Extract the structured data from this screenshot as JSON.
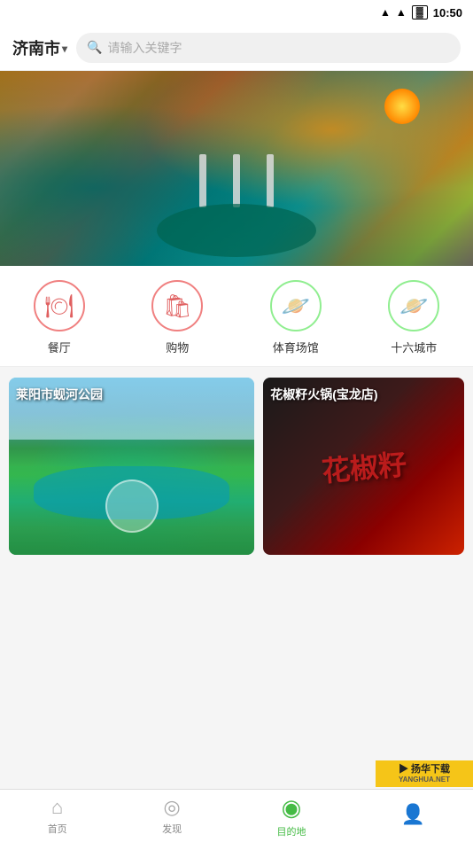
{
  "statusBar": {
    "time": "10:50"
  },
  "header": {
    "city": "济南市",
    "chevron": "▾",
    "search_placeholder": "请输入关键字"
  },
  "categories": [
    {
      "id": "restaurant",
      "label": "餐厅",
      "icon": "🍽",
      "style": "restaurant"
    },
    {
      "id": "shopping",
      "label": "购物",
      "icon": "🛍",
      "style": "shopping"
    },
    {
      "id": "stadium",
      "label": "体育场馆",
      "icon": "🪐",
      "style": "stadium"
    },
    {
      "id": "cities",
      "label": "十六城市",
      "icon": "🪐",
      "style": "cities"
    }
  ],
  "cards": [
    {
      "id": "park",
      "title": "莱阳市蚬河公园",
      "side": "left"
    },
    {
      "id": "restaurant2",
      "title": "花椒籽火锅(宝龙店)",
      "side": "right"
    }
  ],
  "bottomNav": [
    {
      "id": "home",
      "label": "首页",
      "icon": "⌂",
      "active": false
    },
    {
      "id": "discover",
      "label": "发现",
      "icon": "◎",
      "active": false
    },
    {
      "id": "destination",
      "label": "目的地",
      "icon": "◉",
      "active": true
    },
    {
      "id": "profile",
      "label": "",
      "icon": "👤",
      "active": false
    }
  ],
  "watermark": {
    "text": "扬华下载",
    "subtext": "YANGHUA.NET"
  }
}
